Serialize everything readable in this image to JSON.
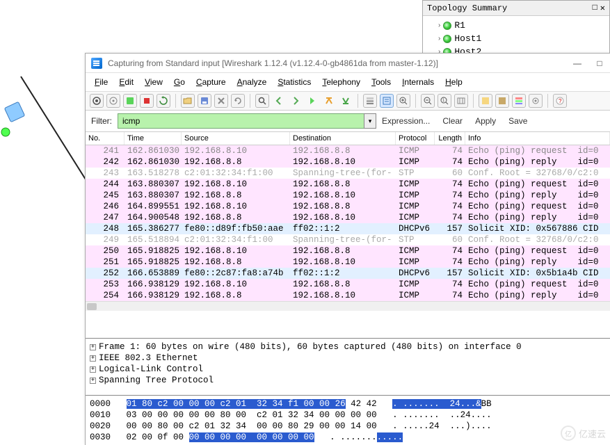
{
  "topology": {
    "title": "Topology Summary",
    "nodes": [
      "R1",
      "Host1",
      "Host2"
    ]
  },
  "window": {
    "title": "Capturing from Standard input      [Wireshark 1.12.4  (v1.12.4-0-gb4861da from master-1.12)]"
  },
  "menus": [
    "File",
    "Edit",
    "View",
    "Go",
    "Capture",
    "Analyze",
    "Statistics",
    "Telephony",
    "Tools",
    "Internals",
    "Help"
  ],
  "filter": {
    "label": "Filter:",
    "value": "icmp",
    "links": [
      "Expression...",
      "Clear",
      "Apply",
      "Save"
    ]
  },
  "columns": [
    "No.",
    "Time",
    "Source",
    "Destination",
    "Protocol",
    "Length",
    "Info"
  ],
  "packets": [
    {
      "cls": "pink cut",
      "no": "241",
      "time": "162.861030",
      "src": "192.168.8.10",
      "dst": "192.168.8.8",
      "proto": "ICMP",
      "len": "74",
      "info": "Echo (ping) request  id=0"
    },
    {
      "cls": "pink",
      "no": "242",
      "time": "162.861030",
      "src": "192.168.8.8",
      "dst": "192.168.8.10",
      "proto": "ICMP",
      "len": "74",
      "info": "Echo (ping) reply    id=0"
    },
    {
      "cls": "gray",
      "no": "243",
      "time": "163.518278",
      "src": "c2:01:32:34:f1:00",
      "dst": "Spanning-tree-(for-",
      "proto": "STP",
      "len": "60",
      "info": "Conf. Root = 32768/0/c2:0"
    },
    {
      "cls": "pink",
      "no": "244",
      "time": "163.880307",
      "src": "192.168.8.10",
      "dst": "192.168.8.8",
      "proto": "ICMP",
      "len": "74",
      "info": "Echo (ping) request  id=0"
    },
    {
      "cls": "pink",
      "no": "245",
      "time": "163.880307",
      "src": "192.168.8.8",
      "dst": "192.168.8.10",
      "proto": "ICMP",
      "len": "74",
      "info": "Echo (ping) reply    id=0"
    },
    {
      "cls": "pink",
      "no": "246",
      "time": "164.899551",
      "src": "192.168.8.10",
      "dst": "192.168.8.8",
      "proto": "ICMP",
      "len": "74",
      "info": "Echo (ping) request  id=0"
    },
    {
      "cls": "pink",
      "no": "247",
      "time": "164.900548",
      "src": "192.168.8.8",
      "dst": "192.168.8.10",
      "proto": "ICMP",
      "len": "74",
      "info": "Echo (ping) reply    id=0"
    },
    {
      "cls": "blue",
      "no": "248",
      "time": "165.386277",
      "src": "fe80::d89f:fb50:aae",
      "dst": "ff02::1:2",
      "proto": "DHCPv6",
      "len": "157",
      "info": "Solicit XID: 0x567886 CID"
    },
    {
      "cls": "gray",
      "no": "249",
      "time": "165.518894",
      "src": "c2:01:32:34:f1:00",
      "dst": "Spanning-tree-(for-",
      "proto": "STP",
      "len": "60",
      "info": "Conf. Root = 32768/0/c2:0"
    },
    {
      "cls": "pink",
      "no": "250",
      "time": "165.918825",
      "src": "192.168.8.10",
      "dst": "192.168.8.8",
      "proto": "ICMP",
      "len": "74",
      "info": "Echo (ping) request  id=0"
    },
    {
      "cls": "pink",
      "no": "251",
      "time": "165.918825",
      "src": "192.168.8.8",
      "dst": "192.168.8.10",
      "proto": "ICMP",
      "len": "74",
      "info": "Echo (ping) reply    id=0"
    },
    {
      "cls": "blue",
      "no": "252",
      "time": "166.653889",
      "src": "fe80::2c87:fa8:a74b",
      "dst": "ff02::1:2",
      "proto": "DHCPv6",
      "len": "157",
      "info": "Solicit XID: 0x5b1a4b CID"
    },
    {
      "cls": "pink",
      "no": "253",
      "time": "166.938129",
      "src": "192.168.8.10",
      "dst": "192.168.8.8",
      "proto": "ICMP",
      "len": "74",
      "info": "Echo (ping) request  id=0"
    },
    {
      "cls": "pink",
      "no": "254",
      "time": "166.938129",
      "src": "192.168.8.8",
      "dst": "192.168.8.10",
      "proto": "ICMP",
      "len": "74",
      "info": "Echo (ping) reply    id=0"
    }
  ],
  "details": [
    "Frame 1: 60 bytes on wire (480 bits), 60 bytes captured (480 bits) on interface 0",
    "IEEE 802.3 Ethernet",
    "Logical-Link Control",
    "Spanning Tree Protocol"
  ],
  "hex": [
    {
      "off": "0000",
      "sel": "01 80 c2 00 00 00 c2 01  32 34 f1 00 00 26",
      "rest": " 42 42",
      "asel": ". .......  24...&",
      "arest": "BB"
    },
    {
      "off": "0010",
      "sel": "",
      "rest": "03 00 00 00 00 00 80 00  c2 01 32 34 00 00 00 00",
      "asel": "",
      "arest": ". .......  ..24...."
    },
    {
      "off": "0020",
      "sel": "",
      "rest": "00 00 80 00 c2 01 32 34  00 00 80 29 00 00 14 00",
      "asel": "",
      "arest": ". .....24  ...)...."
    },
    {
      "off": "0030",
      "sel": "",
      "rest": "02 00 0f 00 ",
      "sel2": "00 00 00 00  00 00 00 00",
      "asel": "",
      "arest": ". .......",
      "asel2": "....."
    }
  ],
  "watermark": "亿速云"
}
